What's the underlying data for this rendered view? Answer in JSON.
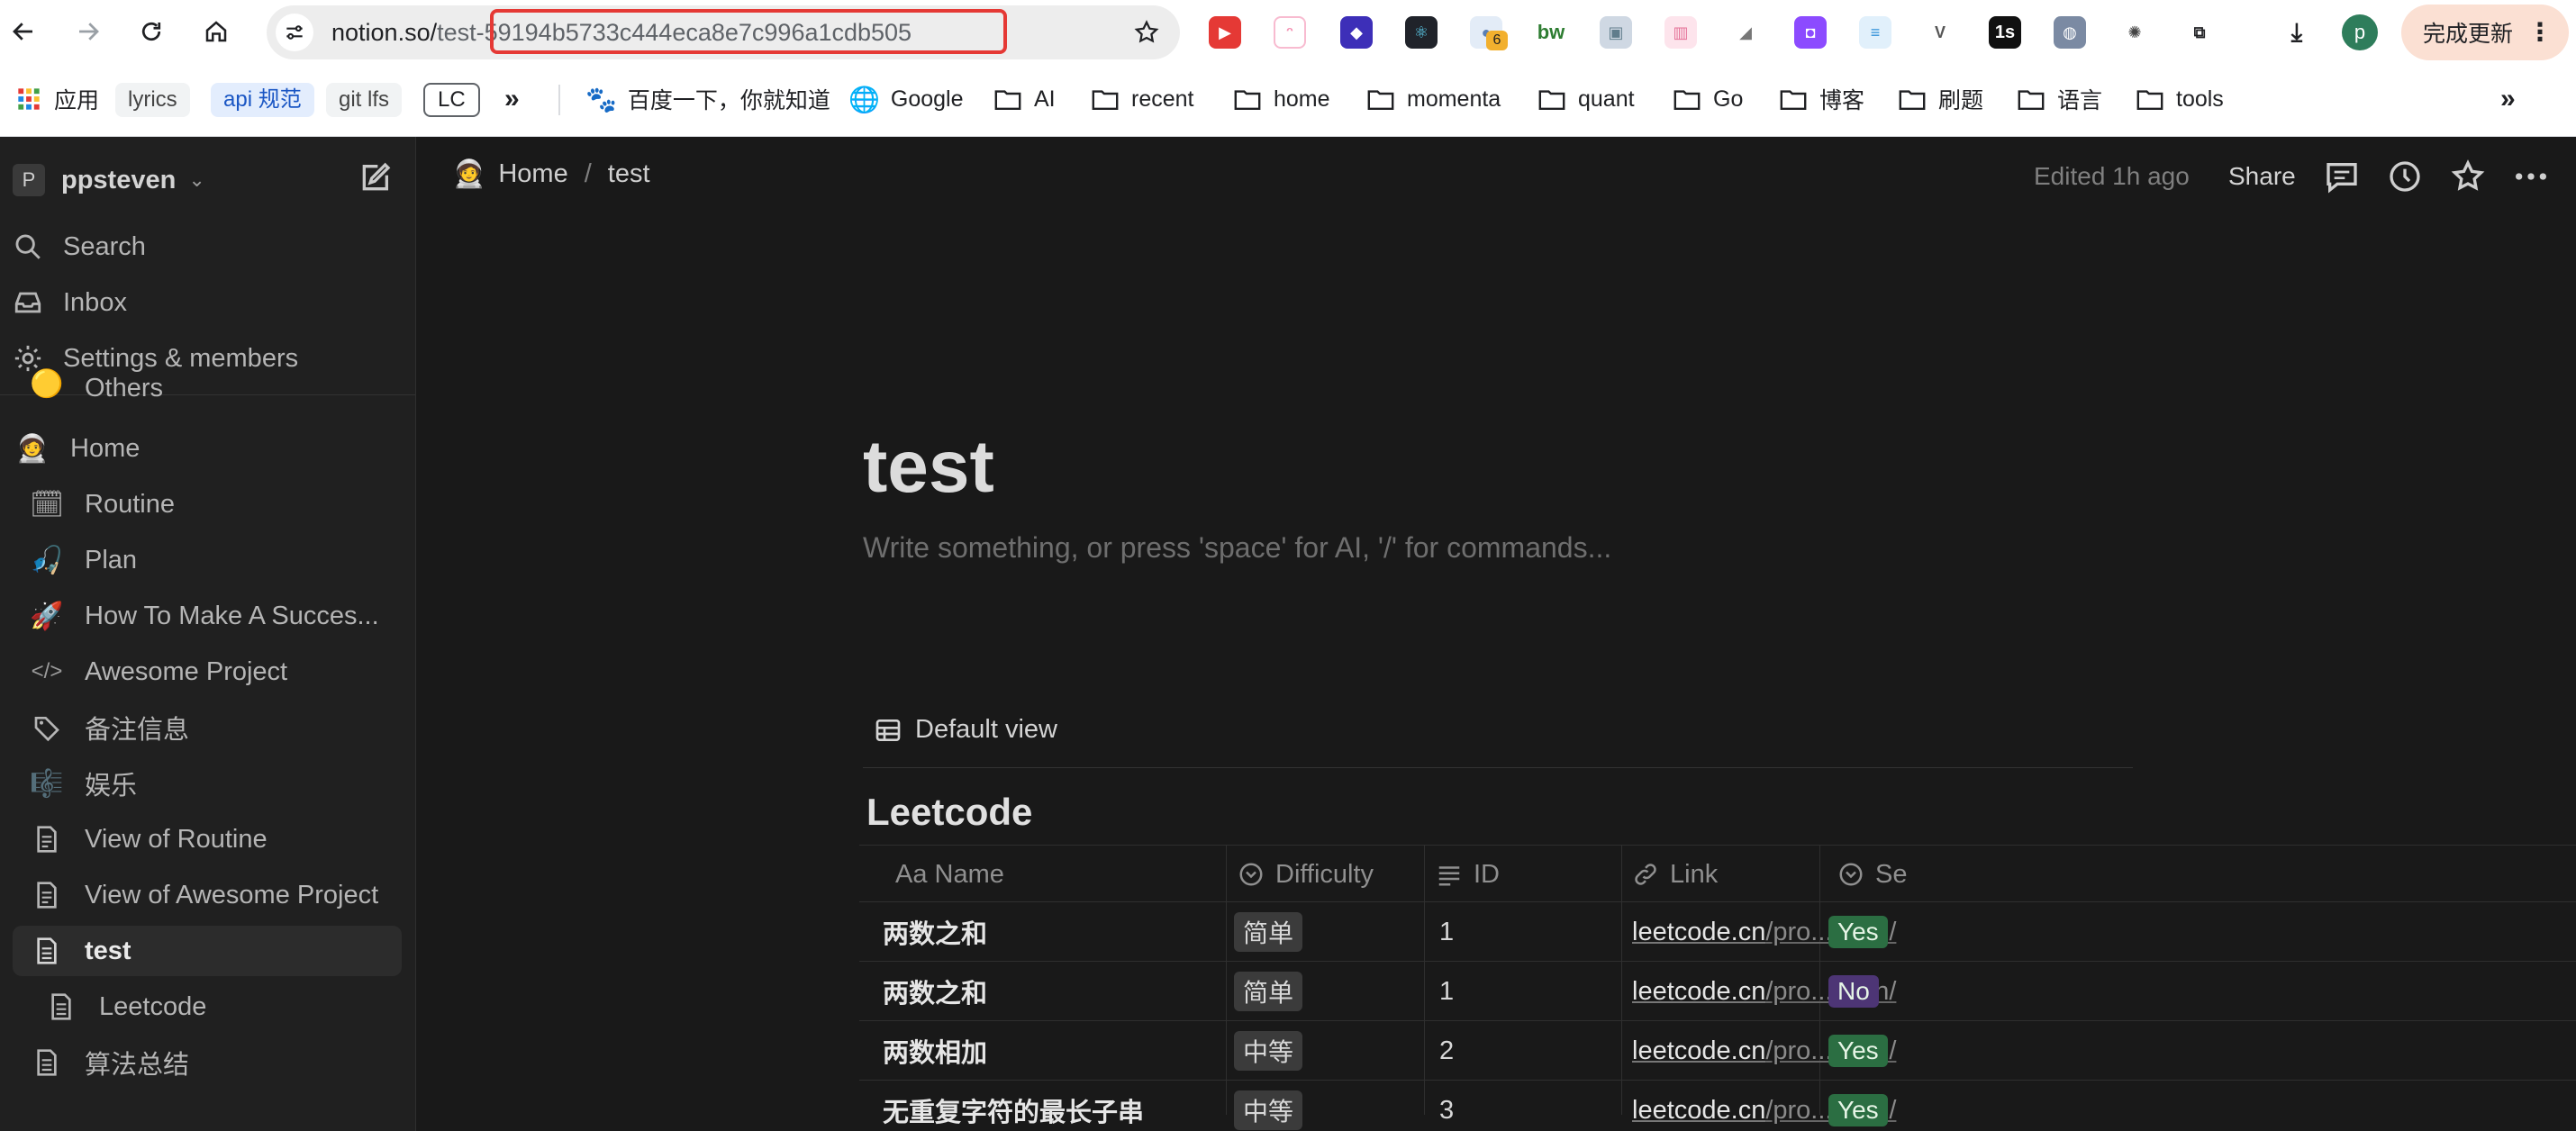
{
  "browser": {
    "url_host": "notion.so/",
    "url_path_dim": "tes",
    "url_rest": "t-59194b5733c444eca8e7c996a1cdb505",
    "extension_badge": "6",
    "profile_initial": "p",
    "update_label": "完成更新",
    "update_menu": "⋮",
    "overflow_glyph": "»",
    "bookmarks": {
      "apps": "应用",
      "chips": [
        "lyrics",
        "api 规范",
        "git lfs",
        "LC"
      ],
      "baidu": "百度一下，你就知道",
      "google": "Google",
      "folders": [
        "AI",
        "recent",
        "home",
        "momenta",
        "quant",
        "Go",
        "博客",
        "刷题",
        "语言",
        "tools"
      ]
    }
  },
  "sidebar": {
    "workspace_initial": "P",
    "workspace_name": "ppsteven",
    "top_items": [
      "Search",
      "Inbox",
      "Settings & members"
    ],
    "partial_item": "Others",
    "pages": [
      {
        "label": "Home",
        "icon": "🧑‍🚀"
      },
      {
        "label": "Routine",
        "icon": "🗓"
      },
      {
        "label": "Plan",
        "icon": "🎣"
      },
      {
        "label": "How To Make A Succes...",
        "icon": "🚀"
      },
      {
        "label": "Awesome Project",
        "icon": "</>"
      },
      {
        "label": "备注信息",
        "icon": "🏷"
      },
      {
        "label": "娱乐",
        "icon": "🎼"
      },
      {
        "label": "View of Routine",
        "icon": "📄"
      },
      {
        "label": "View of Awesome Project",
        "icon": "📄"
      },
      {
        "label": "test",
        "icon": "📄"
      },
      {
        "label": "Leetcode",
        "icon": "📄"
      },
      {
        "label": "算法总结",
        "icon": "📄"
      }
    ]
  },
  "topbar": {
    "breadcrumb_home": "Home",
    "breadcrumb_sep": "/",
    "breadcrumb_page": "test",
    "edited": "Edited 1h ago",
    "share": "Share"
  },
  "page": {
    "title": "test",
    "placeholder": "Write something, or press 'space' for AI, '/' for commands...",
    "view_name": "Default view",
    "database_title": "Leetcode",
    "columns": [
      "Aa Name",
      "Difficulty",
      "ID",
      "Link",
      "Se"
    ],
    "rows": [
      {
        "name": "两数之和",
        "difficulty": "简单",
        "id": "1",
        "link_host": "leetcode.cn",
        "link_rest": "/pro...ption/",
        "status": "Yes",
        "status_color": "#2b6e42"
      },
      {
        "name": "两数之和",
        "difficulty": "简单",
        "id": "1",
        "link_host": "leetcode.cn",
        "link_rest": "/pro...ption/",
        "status": "No",
        "status_color": "#4d3575"
      },
      {
        "name": "两数相加",
        "difficulty": "中等",
        "id": "2",
        "link_host": "leetcode.cn",
        "link_rest": "/pro...ption/",
        "status": "Yes",
        "status_color": "#2b6e42"
      },
      {
        "name": "无重复字符的最长子串",
        "difficulty": "中等",
        "id": "3",
        "link_host": "leetcode.cn",
        "link_rest": "/pro...ption/",
        "status": "Yes",
        "status_color": "#2b6e42"
      }
    ]
  }
}
